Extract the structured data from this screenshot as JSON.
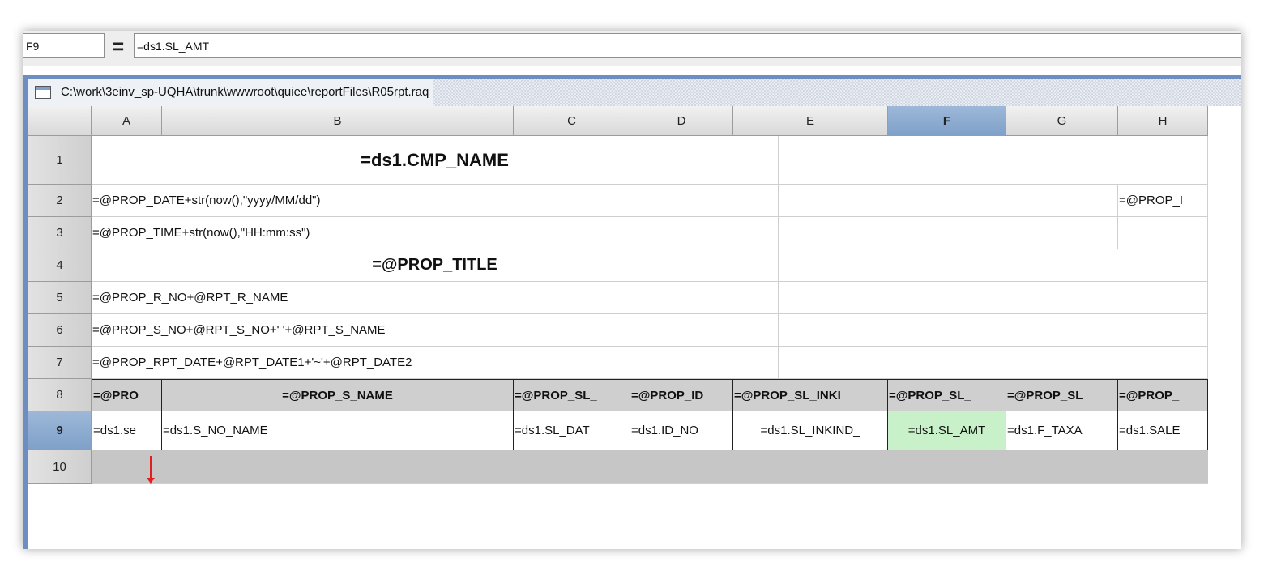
{
  "formula_bar": {
    "cell_ref": "F9",
    "equals": "=",
    "formula": "=ds1.SL_AMT"
  },
  "window": {
    "title": "C:\\work\\3einv_sp-UQHA\\trunk\\wwwroot\\quiee\\reportFiles\\R05rpt.raq"
  },
  "columns": [
    "A",
    "B",
    "C",
    "D",
    "E",
    "F",
    "G",
    "H"
  ],
  "selected_column": "F",
  "rows": [
    "1",
    "2",
    "3",
    "4",
    "5",
    "6",
    "7",
    "8",
    "9",
    "10"
  ],
  "selected_row": "9",
  "cells": {
    "r1_title": "=ds1.CMP_NAME",
    "r2_a": "=@PROP_DATE+str(now(),\"yyyy/MM/dd\")",
    "r2_h": "=@PROP_I",
    "r3_a": "=@PROP_TIME+str(now(),\"HH:mm:ss\")",
    "r4_title": "=@PROP_TITLE",
    "r5_a": "=@PROP_R_NO+@RPT_R_NAME",
    "r6_a": "=@PROP_S_NO+@RPT_S_NO+' '+@RPT_S_NAME",
    "r7_a": "=@PROP_RPT_DATE+@RPT_DATE1+'~'+@RPT_DATE2",
    "r8": [
      "=@PRO",
      "=@PROP_S_NAME",
      "=@PROP_SL_",
      "=@PROP_ID",
      "=@PROP_SL_INKI",
      "=@PROP_SL_",
      "=@PROP_SL",
      "=@PROP_"
    ],
    "r9": [
      "=ds1.se",
      "=ds1.S_NO_NAME",
      "=ds1.SL_DAT",
      "=ds1.ID_NO",
      "=ds1.SL_INKIND_",
      "=ds1.SL_AMT",
      "=ds1.F_TAXA",
      "=ds1.SALE"
    ]
  }
}
